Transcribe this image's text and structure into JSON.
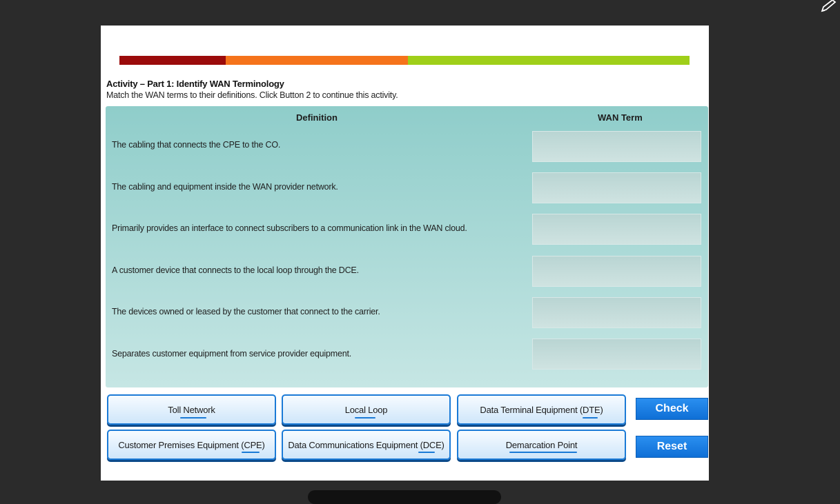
{
  "activity": {
    "title": "Activity – Part 1: Identify WAN Terminology",
    "instructions": "Match the WAN terms to their definitions. Click Button 2 to continue this activity."
  },
  "table": {
    "headers": {
      "definition": "Definition",
      "term": "WAN Term"
    },
    "rows": [
      {
        "definition": "The cabling that connects the CPE to the CO.",
        "term": ""
      },
      {
        "definition": "The cabling and equipment inside the WAN provider network.",
        "term": ""
      },
      {
        "definition": "Primarily provides an interface to connect subscribers to a communication link in the WAN cloud.",
        "term": ""
      },
      {
        "definition": "A customer device that connects to the local loop through the DCE.",
        "term": ""
      },
      {
        "definition": "The devices owned or leased by the customer that connect to the carrier.",
        "term": ""
      },
      {
        "definition": "Separates customer equipment from service provider equipment.",
        "term": ""
      }
    ]
  },
  "terms": [
    "Toll Network",
    "Local Loop",
    "Data Terminal Equipment (DTE)",
    "Customer Premises Equipment (CPE)",
    "Data Communications Equipment (DCE)",
    "Demarcation Point"
  ],
  "actions": {
    "check": "Check",
    "reset": "Reset"
  },
  "colors": {
    "bar_red": "#9b0b0b",
    "bar_orange": "#f5731b",
    "bar_green": "#9fcf19",
    "button_blue": "#1a7ad6"
  },
  "icons": {
    "top_right": "pen-icon"
  }
}
